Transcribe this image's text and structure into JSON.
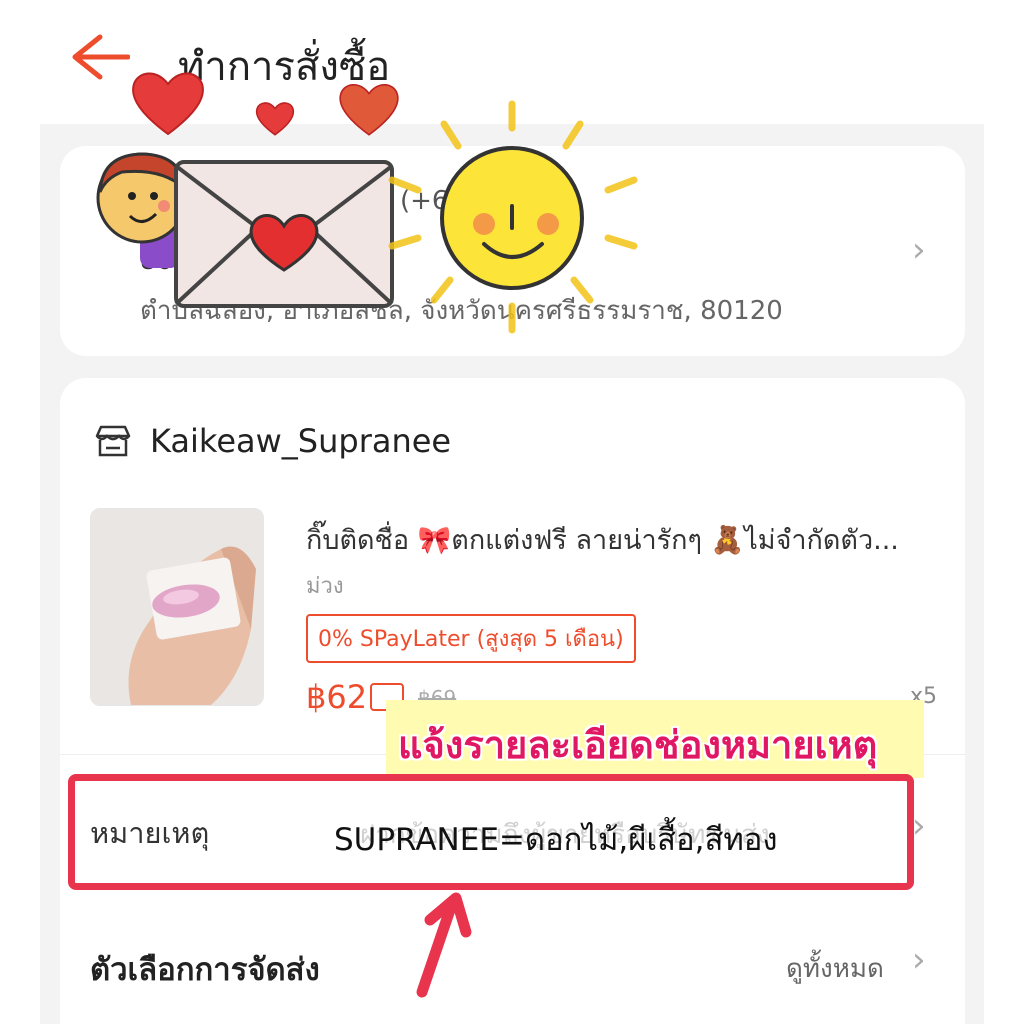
{
  "header": {
    "title": "ทำการสั่งซื้อ"
  },
  "address": {
    "line1": "(+66)  59",
    "postal_prefix": "80",
    "line3": "ตำบลฉลอง, อำเภอสิชล, จังหวัดนครศรีธรรมราช, 80120"
  },
  "shop": {
    "name": "Kaikeaw_Supranee"
  },
  "product": {
    "title": "กิ๊บติดชื่อ 🎀ตกแต่งฟรี ลายน่ารักๆ 🧸ไม่จำกัดตัว...",
    "variant": "ม่วง",
    "promo_badge": "0% SPayLater (สูงสุด 5 เดือน)",
    "price": "฿62",
    "original_price": "฿69",
    "quantity": "x5"
  },
  "note": {
    "label": "หมายเหตุ",
    "placeholder": "ฝากข้อความถึงผู้ขายหรือบริษัทขนส่ง",
    "value": "SUPRANEE=ดอกไม้,ผีเสื้อ,สีทอง"
  },
  "annotation": {
    "banner_text": "แจ้งรายละเอียดช่องหมายเหตุ"
  },
  "shipping": {
    "label": "ตัวเลือกการจัดส่ง",
    "view_all": "ดูทั้งหมด"
  },
  "colors": {
    "accent": "#ee4d2d",
    "highlight_border": "#e8344d",
    "banner_bg": "#fffbb0",
    "banner_text": "#e01863"
  },
  "icons": {
    "back": "arrow-left-icon",
    "shop": "store-icon",
    "chevron": "chevron-right-icon"
  }
}
